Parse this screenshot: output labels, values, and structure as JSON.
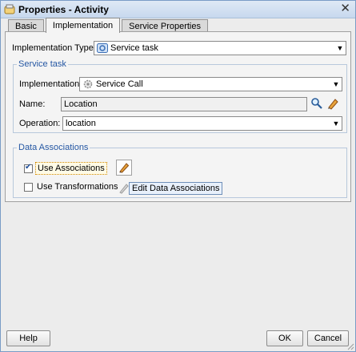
{
  "window": {
    "title": "Properties - Activity"
  },
  "tabs": [
    {
      "label": "Basic",
      "active": false
    },
    {
      "label": "Implementation",
      "active": true
    },
    {
      "label": "Service Properties",
      "active": false
    }
  ],
  "implementation_type": {
    "label": "Implementation Type:",
    "value": "Service task",
    "icon": "service-task-icon"
  },
  "service_task": {
    "legend": "Service task",
    "implementation": {
      "label": "Implementation:",
      "value": "Service Call",
      "icon": "service-call-gear-icon"
    },
    "name": {
      "label": "Name:",
      "value": "Location"
    },
    "operation": {
      "label": "Operation:",
      "value": "location"
    }
  },
  "data_associations": {
    "legend": "Data Associations",
    "use_associations": {
      "label": "Use Associations",
      "checked": true
    },
    "use_transformations": {
      "label": "Use Transformations",
      "checked": false
    },
    "tooltip": "Edit Data Associations"
  },
  "buttons": {
    "help": "Help",
    "ok": "OK",
    "cancel": "Cancel"
  },
  "colors": {
    "group_legend": "#2557a3",
    "title_bar": "#c7d8ee"
  }
}
